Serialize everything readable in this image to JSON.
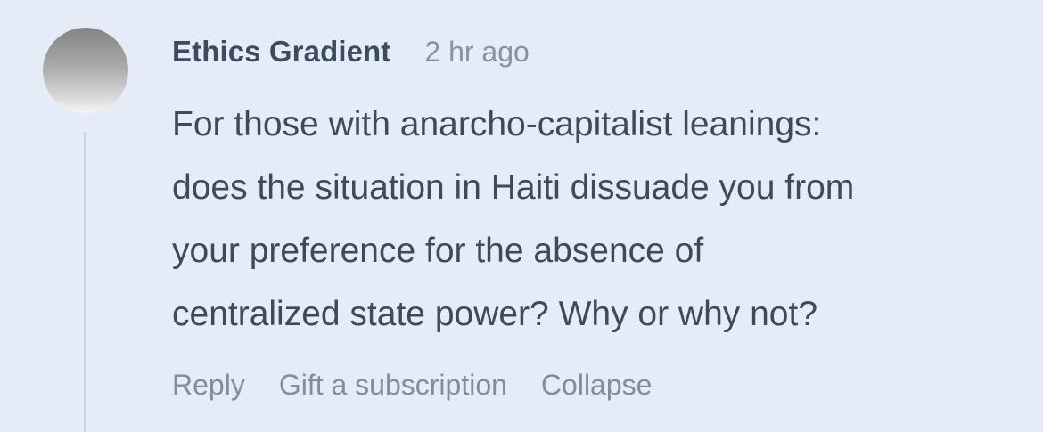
{
  "comment": {
    "author": "Ethics Gradient",
    "timestamp": "2 hr ago",
    "body_lines": [
      "For those with anarcho-capitalist leanings:",
      "does the situation in Haiti dissuade you from",
      "your preference for the absence of",
      "centralized state power? Why or why not?"
    ],
    "actions": {
      "reply": "Reply",
      "gift": "Gift a subscription",
      "collapse": "Collapse"
    }
  },
  "colors": {
    "background": "#e4ecf8",
    "author": "#3e4a5e",
    "body": "#3f495b",
    "muted": "#858c97",
    "thread_line": "#c9d2de"
  }
}
